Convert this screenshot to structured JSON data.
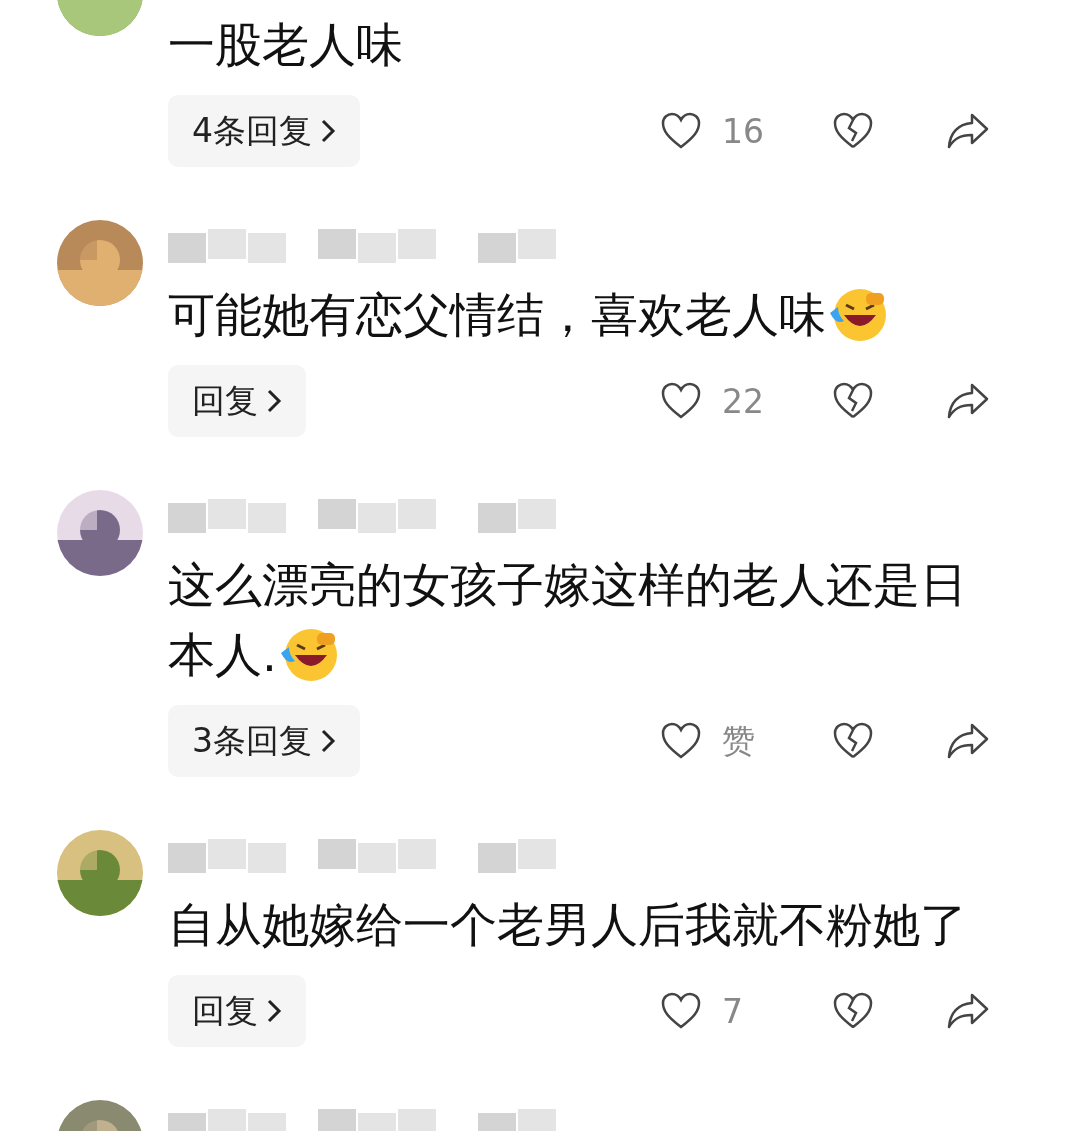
{
  "comments": [
    {
      "kind": "full",
      "name_cut": true,
      "lines": [
        "一股老人味"
      ],
      "emoji": false,
      "reply_label": "4条回复",
      "likes": "16"
    },
    {
      "kind": "full",
      "lines": [
        "可能她有恋父情结，喜欢老人味"
      ],
      "emoji": true,
      "reply_label": "回复",
      "likes": "22"
    },
    {
      "kind": "full",
      "lines": [
        "这么漂亮的女孩子嫁这样的老人还是日",
        "本人."
      ],
      "emoji": true,
      "reply_label": "3条回复",
      "likes": "赞"
    },
    {
      "kind": "full",
      "lines": [
        "自从她嫁给一个老男人后我就不粉她了"
      ],
      "emoji": false,
      "reply_label": "回复",
      "likes": "7"
    },
    {
      "kind": "name_only"
    }
  ]
}
